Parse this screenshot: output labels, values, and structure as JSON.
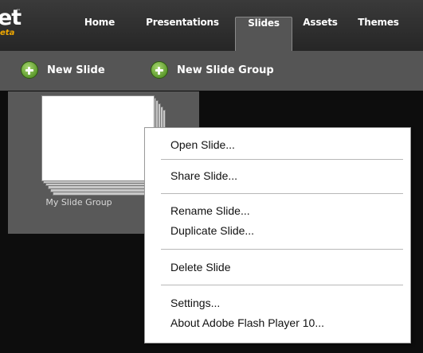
{
  "app": {
    "logo_text": "et",
    "logo_tm": "™",
    "logo_sub": "eta"
  },
  "nav": {
    "tabs": [
      {
        "label": "Home",
        "active": false
      },
      {
        "label": "Presentations",
        "active": false
      },
      {
        "label": "Slides",
        "active": true
      },
      {
        "label": "Assets",
        "active": false
      },
      {
        "label": "Themes",
        "active": false
      }
    ]
  },
  "toolbar": {
    "new_slide_label": "New Slide",
    "new_slide_group_label": "New Slide Group",
    "icon": "plus-circle-icon"
  },
  "content": {
    "slide_group": {
      "label": "My Slide Group"
    }
  },
  "context_menu": {
    "items": [
      {
        "label": "Open Slide..."
      },
      {
        "label": "Share Slide..."
      },
      {
        "label": "Rename Slide..."
      },
      {
        "label": "Duplicate Slide..."
      },
      {
        "label": "Delete Slide"
      },
      {
        "label": "Settings..."
      },
      {
        "label": "About Adobe Flash Player 10..."
      }
    ]
  },
  "colors": {
    "background": "#0d0d0d",
    "toolbar": "#555555",
    "accent_green": "#5e9a2e",
    "logo_orange": "#f0a800"
  }
}
